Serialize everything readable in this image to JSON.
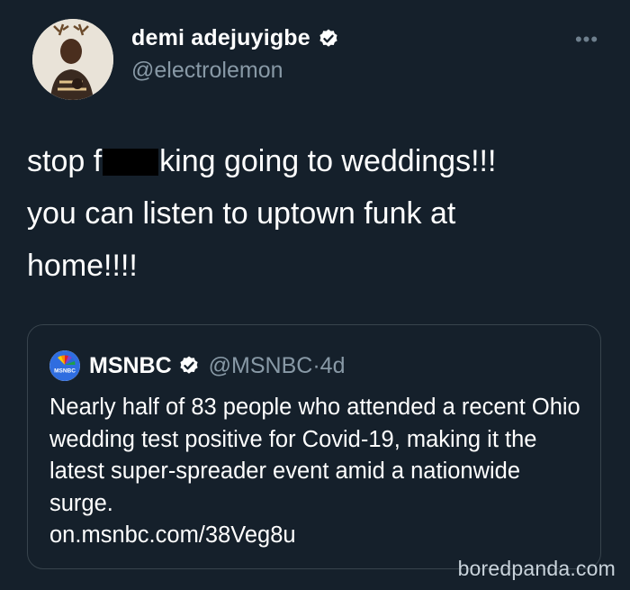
{
  "tweet": {
    "display_name": "demi adejuyigbe",
    "handle": "@electrolemon",
    "more_icon": "more-horizontal-icon",
    "text_line1_before": "stop f",
    "text_line1_after": "king going to weddings!!!",
    "text_line2": "you can listen to uptown funk at",
    "text_line3": "home!!!!"
  },
  "quote": {
    "display_name": "MSNBC",
    "handle": "@MSNBC",
    "separator": "·",
    "age": "4d",
    "text": "Nearly half of 83 people who attended a recent Ohio wedding test positive for Covid-19, making it the latest super-spreader event amid a nationwide surge.",
    "link": "on.msnbc.com/38Veg8u"
  },
  "watermark": "boredpanda.com",
  "colors": {
    "background": "#15202b",
    "secondary_text": "#8899a6",
    "verified_badge": "#ffffff",
    "quote_border": "#38444d"
  }
}
